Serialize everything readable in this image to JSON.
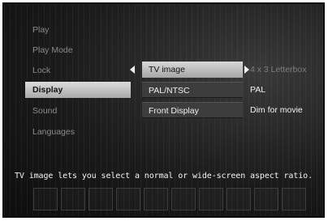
{
  "main_menu": {
    "items": [
      {
        "label": "Play"
      },
      {
        "label": "Play Mode"
      },
      {
        "label": "Lock"
      },
      {
        "label": "Display"
      },
      {
        "label": "Sound"
      },
      {
        "label": "Languages"
      }
    ],
    "selected": "Display"
  },
  "display_submenu": {
    "rows": [
      {
        "label": "TV image",
        "value": "4 x 3 Letterbox"
      },
      {
        "label": "PAL/NTSC",
        "value": "PAL"
      },
      {
        "label": "Front Display",
        "value": "Dim for movie"
      }
    ],
    "highlighted": "TV image"
  },
  "help_text": "TV image lets you select a normal or wide-screen aspect ratio.",
  "icons": {
    "left": "arrow-left-icon",
    "right": "arrow-right-icon"
  }
}
